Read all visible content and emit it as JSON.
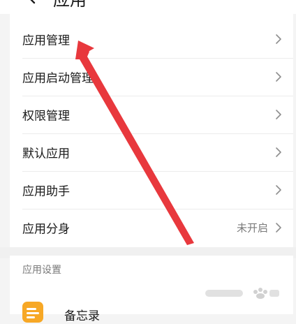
{
  "header": {
    "title": "应用",
    "back_icon": "back-icon"
  },
  "menu": {
    "items": [
      {
        "label": "应用管理",
        "value": "",
        "icon": "chevron-right-icon"
      },
      {
        "label": "应用启动管理",
        "value": "",
        "icon": "chevron-right-icon"
      },
      {
        "label": "权限管理",
        "value": "",
        "icon": "chevron-right-icon"
      },
      {
        "label": "默认应用",
        "value": "",
        "icon": "chevron-right-icon"
      },
      {
        "label": "应用助手",
        "value": "",
        "icon": "chevron-right-icon"
      },
      {
        "label": "应用分身",
        "value": "未开启",
        "icon": "chevron-right-icon"
      }
    ]
  },
  "settings": {
    "section_title": "应用设置",
    "apps": [
      {
        "label": "备忘录",
        "icon": "memo-app-icon"
      }
    ]
  },
  "annotation": {
    "color": "#e8383d",
    "icon": "red-arrow-annotation"
  },
  "colors": {
    "background": "#f4f4f4",
    "card": "#ffffff",
    "text_primary": "#1a1a1a",
    "text_secondary": "#7a7a7a",
    "memo_icon": "#f7a826"
  }
}
